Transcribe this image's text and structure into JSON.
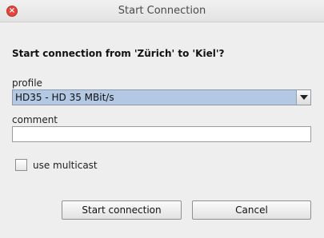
{
  "window": {
    "title": "Start Connection",
    "close_symbol": "×"
  },
  "dialog": {
    "question": "Start connection from 'Zürich' to 'Kiel'?",
    "profile_label": "profile",
    "profile_selected": "HD35 - HD 35 MBit/s",
    "comment_label": "comment",
    "comment_value": "",
    "multicast_label": "use multicast",
    "multicast_checked": false,
    "start_button": "Start connection",
    "cancel_button": "Cancel"
  },
  "icons": {
    "close": "close-icon",
    "dropdown": "chevron-down-icon"
  },
  "colors": {
    "close_red": "#e2463d",
    "selected_highlight": "#b3c8e3"
  }
}
